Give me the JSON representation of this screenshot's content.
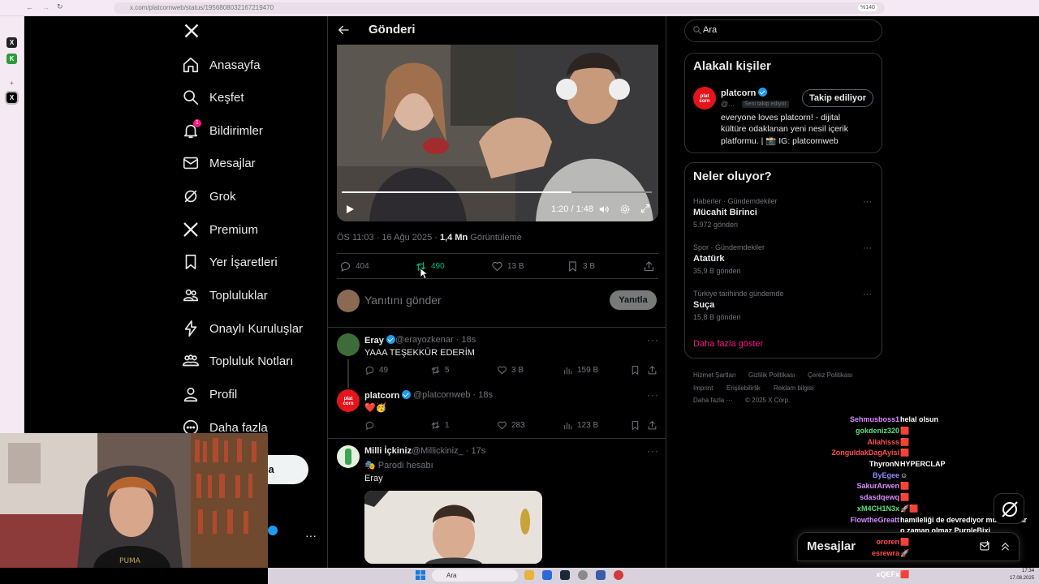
{
  "browser": {
    "url": "x.com/platcornweb/status/1956808032167219470",
    "zoom": "%140"
  },
  "nav": {
    "items": [
      {
        "label": "Anasayfa",
        "icon": "home-icon"
      },
      {
        "label": "Keşfet",
        "icon": "search-icon"
      },
      {
        "label": "Bildirimler",
        "icon": "bell-icon",
        "badge": "1"
      },
      {
        "label": "Mesajlar",
        "icon": "mail-icon"
      },
      {
        "label": "Grok",
        "icon": "grok-icon"
      },
      {
        "label": "Premium",
        "icon": "x-logo-icon"
      },
      {
        "label": "Yer İşaretleri",
        "icon": "bookmark-icon"
      },
      {
        "label": "Topluluklar",
        "icon": "communities-icon"
      },
      {
        "label": "Onaylı Kuruluşlar",
        "icon": "lightning-icon"
      },
      {
        "label": "Topluluk Notları",
        "icon": "community-notes-icon"
      },
      {
        "label": "Profil",
        "icon": "person-icon"
      },
      {
        "label": "Daha fazla",
        "icon": "more-circle-icon"
      }
    ],
    "post_button": "nla"
  },
  "header": {
    "title": "Gönderi"
  },
  "video": {
    "time": "1:20 / 1:48",
    "progress": 0.74
  },
  "post": {
    "meta_time": "ÖS 11:03 · 16 Ağu 2025 · ",
    "views_count": "1,4 Mn",
    "views_label": " Görüntüleme",
    "replies": "404",
    "reposts": "490",
    "likes": "13 B",
    "bookmarks": "3 B"
  },
  "reply_box": {
    "placeholder": "Yanıtını gönder",
    "button": "Yanıtla"
  },
  "tweets": [
    {
      "name": "Eray",
      "handle": "@erayozkenar · 18s",
      "text": "YAAA TEŞEKKÜR EDERİM",
      "replies": "49",
      "reposts": "5",
      "likes": "3 B",
      "views": "159 B"
    },
    {
      "name": "platcorn",
      "handle": "@platcornweb · 18s",
      "text": "❤️🥳",
      "replies": "",
      "reposts": "1",
      "likes": "283",
      "views": "123 B"
    },
    {
      "name": "Milli İçkiniz",
      "handle": "@Millickiniz_ · 17s",
      "label": "Parodi hesabı",
      "text": "Eray"
    }
  ],
  "search": {
    "placeholder": "Ara"
  },
  "related": {
    "title": "Alakalı kişiler",
    "name": "platcorn",
    "handle": "@...",
    "follows_you": "Seni takip ediyor",
    "follow_button": "Takip ediliyor",
    "bio_lines": [
      "everyone loves platcorn! - dijital",
      "kültüre odaklanan yeni nesil içerik",
      "platformu. | 📸 IG: platcornweb"
    ]
  },
  "trends": {
    "title": "Neler oluyor?",
    "items": [
      {
        "category": "Haberler · Gündemdekiler",
        "name": "Mücahit Birinci",
        "count": "5.972 gönderi"
      },
      {
        "category": "Spor · Gündemdekiler",
        "name": "Atatürk",
        "count": "35,9 B gönderi"
      },
      {
        "category": "Türkiye tarihinde gündemde",
        "name": "Suça",
        "count": "15,8 B gönderi"
      }
    ],
    "show_more": "Daha fazla göster"
  },
  "footer": {
    "row1": [
      "Hizmet Şartları",
      "Gizlilik Politikası",
      "Çerez Politikası"
    ],
    "row2": [
      "Imprint",
      "Erişilebilirlik",
      "Reklam bilgisi"
    ],
    "more": "Daha fazla ···",
    "copyright": "© 2025 X Corp."
  },
  "chat": [
    {
      "user": "Sehmusboss1",
      "color": "#d98cff",
      "msg": "helal olsun"
    },
    {
      "user": "gokdeniz320",
      "color": "#5de07a",
      "msg": "🟥"
    },
    {
      "user": "Allahisss",
      "color": "#ff4d4d",
      "msg": "🟥"
    },
    {
      "user": "ZonguldakDagAyisi",
      "color": "#ff4d4d",
      "msg": "🟥"
    },
    {
      "user": "ThyronN",
      "color": "#ffffff",
      "msg": "HYPERCLAP"
    },
    {
      "user": "ByEgee",
      "color": "#8f8cff",
      "msg": "☺"
    },
    {
      "user": "SakurArwen",
      "color": "#d98cff",
      "msg": "🟥"
    },
    {
      "user": "sdasdqewq",
      "color": "#d98cff",
      "msg": "🟥"
    },
    {
      "user": "xM4CH1N3x",
      "color": "#5de07a",
      "msg": "🚀🟥"
    },
    {
      "user": "FlowtheGreatt",
      "color": "#d98cff",
      "msg": "hamileliği de devrediyor mu kadınlar"
    },
    {
      "user": "",
      "color": "#ffffff",
      "msg": "o zaman olmaz PurpleBixi"
    },
    {
      "user": "ororen",
      "color": "#ff4d4d",
      "msg": "🟥"
    },
    {
      "user": "esrewra",
      "color": "#ff4d4d",
      "msg": "🚀"
    },
    {
      "user": "xQEFx",
      "color": "#ffffff",
      "msg": "🟥"
    }
  ],
  "messages_dock": {
    "title": "Mesajlar"
  },
  "taskbar": {
    "search": "Ara",
    "time": "17:34",
    "date": "17.08.2025"
  }
}
